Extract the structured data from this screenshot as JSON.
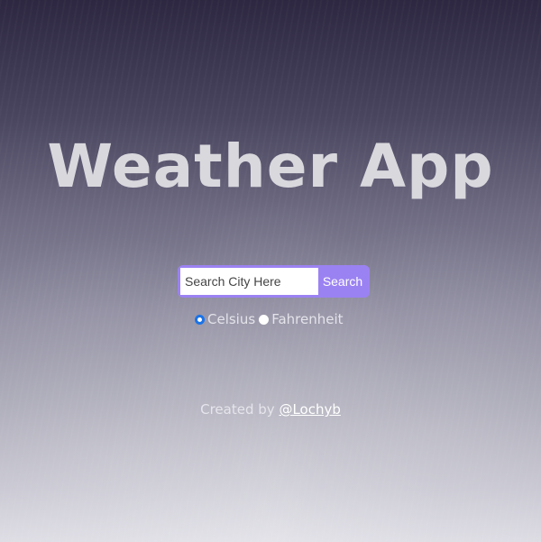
{
  "header": {
    "title": "Weather App"
  },
  "search": {
    "placeholder": "Search City Here",
    "value": "",
    "button_label": "Search"
  },
  "units": {
    "options": [
      {
        "label": "Celsius",
        "selected": true
      },
      {
        "label": "Fahrenheit",
        "selected": false
      }
    ]
  },
  "footer": {
    "prefix": "Created by",
    "link_text": "@Lochyb"
  },
  "colors": {
    "accent": "#9b82f2",
    "title": "#d9d8dd",
    "radio_selected": "#1a73e8"
  }
}
